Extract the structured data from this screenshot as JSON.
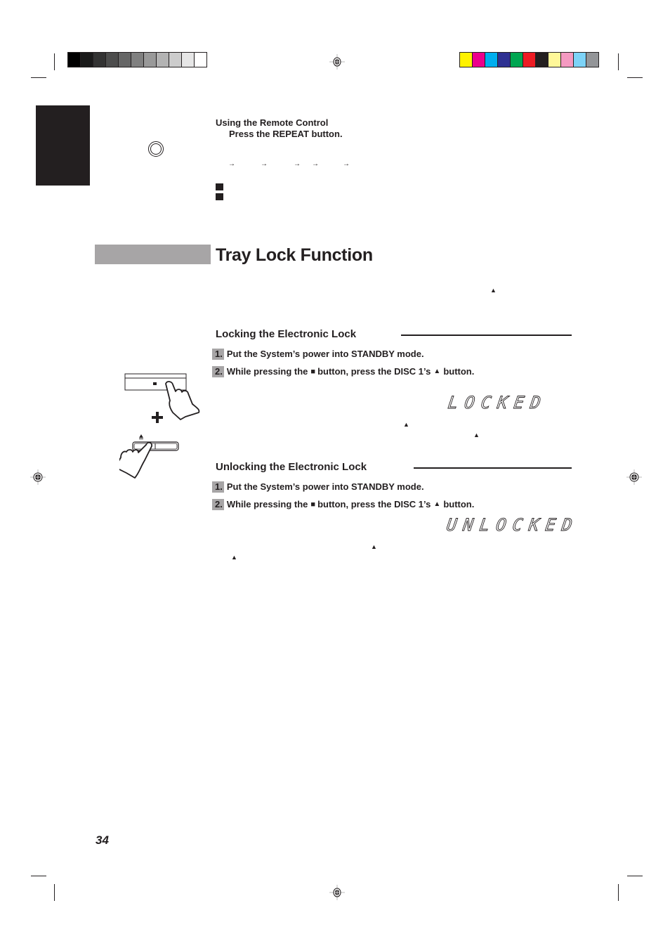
{
  "document": {
    "page_number": "34",
    "remote_section": {
      "heading": "Using the Remote Control",
      "step": "Press the REPEAT button.",
      "repeat_button_icon": "repeat-button-icon"
    },
    "section_title": "Tray Lock Function",
    "locking": {
      "heading": "Locking the Electronic Lock",
      "steps": [
        {
          "num": "1.",
          "text": "Put the System’s power into STANDBY mode."
        },
        {
          "num": "2.",
          "text_before": "While pressing the ",
          "stop_symbol": "■",
          "text_middle": " button, press the DISC 1’s ",
          "eject_symbol": "⏏",
          "text_after": " button."
        }
      ],
      "display_readout": "LOCKED"
    },
    "unlocking": {
      "heading": "Unlocking the Electronic Lock",
      "steps": [
        {
          "num": "1.",
          "text": "Put the System’s power into STANDBY mode."
        },
        {
          "num": "2.",
          "text_before": "While pressing the ",
          "stop_symbol": "■",
          "text_middle": " button, press the DISC 1’s ",
          "eject_symbol": "⏏",
          "text_after": " button."
        }
      ],
      "display_readout": "UNLOCKED"
    },
    "illustration": {
      "plus_sign": "+",
      "stop_symbol": "■",
      "eject_symbol": "▲"
    },
    "symbols": {
      "arrow": "→",
      "eject": "▲"
    },
    "colors": {
      "ink": "#231f20",
      "section_gray": "#a7a5a6",
      "grayscale_bar": [
        "#000000",
        "#1a1a1a",
        "#333333",
        "#4d4d4d",
        "#666666",
        "#808080",
        "#999999",
        "#b3b3b3",
        "#cccccc",
        "#e6e6e6",
        "#ffffff"
      ],
      "color_bar": [
        "#fff200",
        "#ec008c",
        "#00aeef",
        "#2e3192",
        "#00a651",
        "#ed1c24",
        "#231f20",
        "#fff799",
        "#f49ac1",
        "#7dd3f7",
        "#939598"
      ]
    }
  }
}
